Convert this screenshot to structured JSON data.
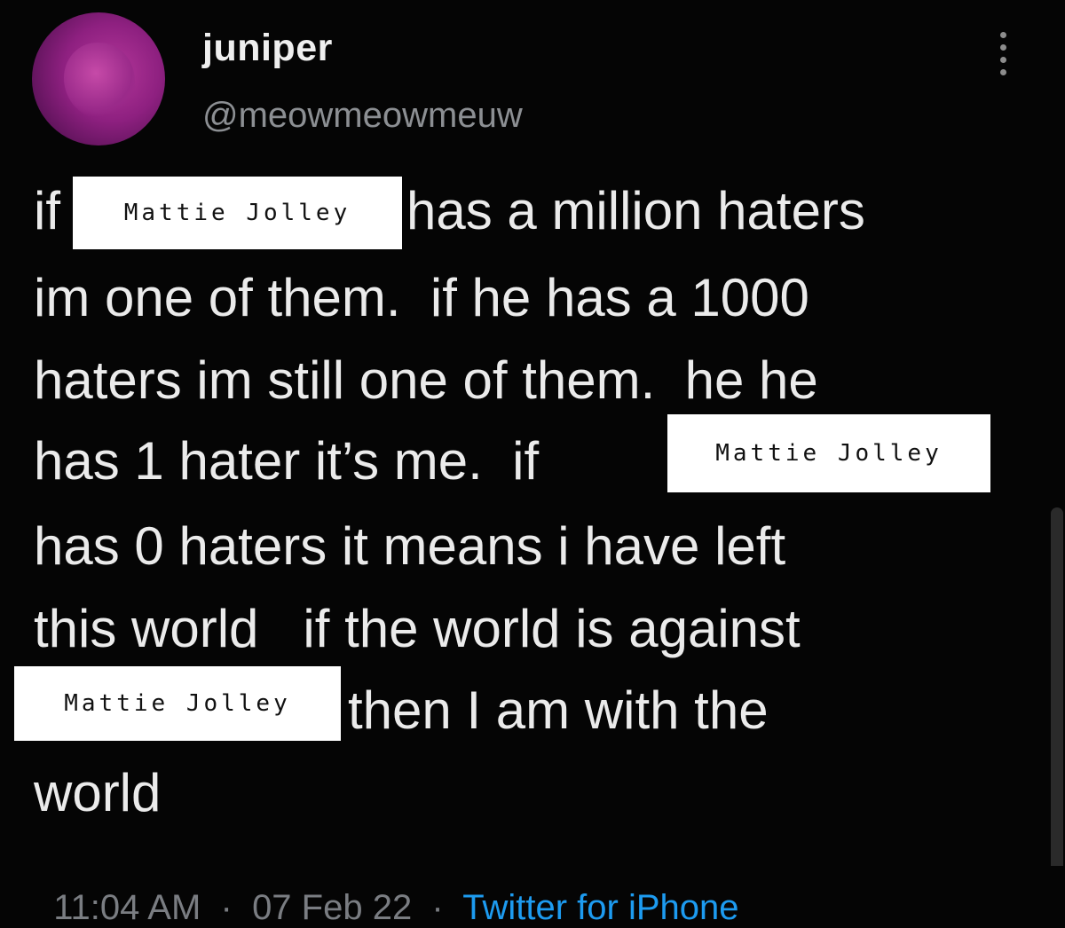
{
  "tweet": {
    "display_name": "juniper",
    "handle": "@meowmeowmeuw",
    "redaction_label": "Mattie Jolley",
    "lines": {
      "l1_pre": "if",
      "l1_post": "has a million haters",
      "l2": "im one of them.  if he has a 1000",
      "l3": "haters im still one of them.  he he",
      "l4_pre": "has 1 hater it’s me.  if",
      "l5": "has 0 haters it means i have left",
      "l6": "this world   if the world is against",
      "l7_post": "then I am with the",
      "l8": "world"
    },
    "meta": {
      "time": "11:04 AM",
      "date": "07 Feb 22",
      "source": "Twitter for iPhone"
    }
  },
  "icons": {
    "more": "more-vertical-icon",
    "avatar": "profile-avatar"
  },
  "colors": {
    "background": "#050505",
    "text": "#ebebeb",
    "handle": "#8c8f93",
    "accent": "#1d9bf0"
  }
}
